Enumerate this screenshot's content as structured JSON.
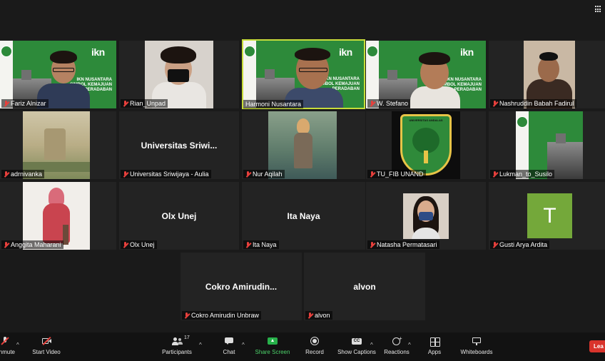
{
  "participants": [
    {
      "name": "Fariz Alnizar",
      "type": "video-ikn"
    },
    {
      "name": "Rian_Unpad",
      "type": "video-person"
    },
    {
      "name": "Harmoni Nusantara",
      "type": "video-ikn",
      "active_speaker": true
    },
    {
      "name": "W. Stefano",
      "type": "video-ikn"
    },
    {
      "name": "Nashruddin Babah Fadirul",
      "type": "video-person"
    },
    {
      "name": "adrnivanka",
      "type": "image"
    },
    {
      "name": "Universitas Sriwijaya - Aulia",
      "display_name": "Universitas  Sriwi...",
      "type": "name-only"
    },
    {
      "name": "Nur Aqilah",
      "type": "image"
    },
    {
      "name": "TU_FIB UNAND",
      "type": "image"
    },
    {
      "name": "Lukman_to_Susilo",
      "type": "image-ikn"
    },
    {
      "name": "Anggita Maharani",
      "type": "image"
    },
    {
      "name": "Olx Unej",
      "display_name": "Olx Unej",
      "type": "name-only"
    },
    {
      "name": "Ita Naya",
      "display_name": "Ita Naya",
      "type": "name-only"
    },
    {
      "name": "Natasha Permatasari",
      "type": "video-person"
    },
    {
      "name": "Gusti Arya Ardita",
      "type": "avatar",
      "avatar_letter": "T"
    },
    {
      "name": "Cokro Amirudin Unbraw",
      "display_name": "Cokro  Amirudin...",
      "type": "name-only"
    },
    {
      "name": "alvon",
      "display_name": "alvon",
      "type": "name-only"
    }
  ],
  "ikn_brand": "ikn",
  "ikn_caption": [
    "IKN NUSANTARA",
    "SIMBOL KEMAJUAN",
    "PERADABAN"
  ],
  "seal_caption": "UNIVERSITAS ANDALAS",
  "toolbar": {
    "mute": "Unmute",
    "video": "Start Video",
    "participants": "Participants",
    "participants_count": "17",
    "chat": "Chat",
    "share": "Share Screen",
    "record": "Record",
    "captions": "Show Captions",
    "reactions": "Reactions",
    "apps": "Apps",
    "whiteboards": "Whiteboards",
    "leave": "Lea"
  },
  "colors": {
    "background": "#1a1a1a",
    "tile": "#232323",
    "active_border": "#c7dc3a",
    "share_green": "#27b04a",
    "leave_red": "#d9342c",
    "avatar_green": "#74a83a",
    "ikn_green": "#2d8a3a"
  }
}
